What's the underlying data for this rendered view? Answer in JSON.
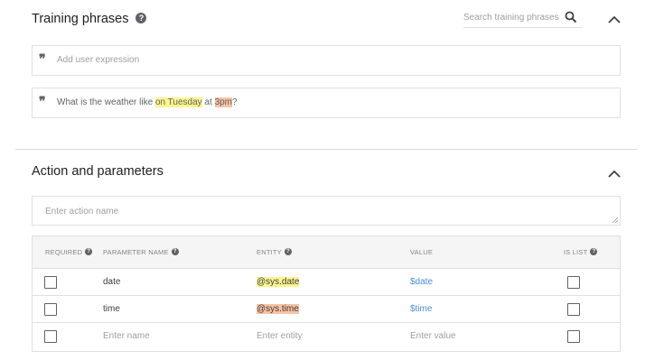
{
  "training": {
    "title": "Training phrases",
    "search_placeholder": "Search training phrases",
    "add_placeholder": "Add user expression",
    "phrase": {
      "prefix": "What is the weather like ",
      "date_text": "on Tuesday",
      "middle": " at ",
      "time_text": "3pm",
      "suffix": "?"
    }
  },
  "action": {
    "title": "Action and parameters",
    "action_placeholder": "Enter action name"
  },
  "params": {
    "headers": {
      "required": "REQUIRED",
      "name": "PARAMETER NAME",
      "entity": "ENTITY",
      "value": "VALUE",
      "is_list": "IS LIST"
    },
    "rows": [
      {
        "name": "date",
        "entity": "@sys.date",
        "value": "$date",
        "required": false,
        "is_list": false
      },
      {
        "name": "time",
        "entity": "@sys.time",
        "value": "$time",
        "required": false,
        "is_list": false
      }
    ],
    "new_row": {
      "name_placeholder": "Enter name",
      "entity_placeholder": "Enter entity",
      "value_placeholder": "Enter value"
    }
  },
  "colors": {
    "date_highlight": "#fdf58c",
    "time_highlight": "#f8c2a3",
    "value_link": "#4a90e2"
  },
  "icons": {
    "help": "question-circle-icon",
    "search": "magnifier-icon",
    "collapse": "chevron-up-icon",
    "quote": "quote-icon"
  }
}
